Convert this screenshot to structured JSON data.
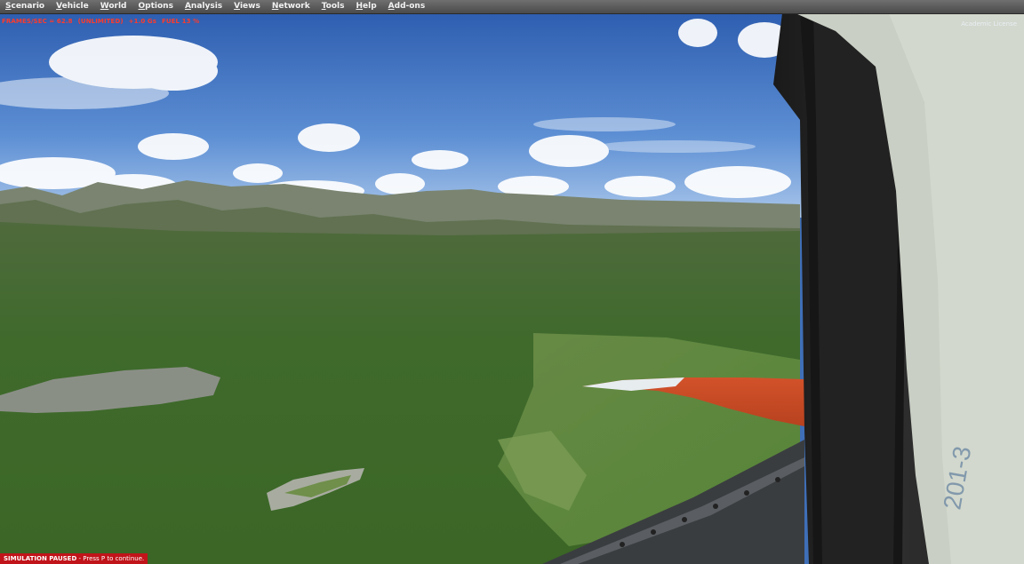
{
  "menu": {
    "items": [
      {
        "ul": "S",
        "rest": "cenario"
      },
      {
        "ul": "V",
        "rest": "ehicle"
      },
      {
        "ul": "W",
        "rest": "orld"
      },
      {
        "ul": "O",
        "rest": "ptions"
      },
      {
        "ul": "A",
        "rest": "nalysis"
      },
      {
        "ul": "V",
        "rest": "iews"
      },
      {
        "ul": "N",
        "rest": "etwork"
      },
      {
        "ul": "T",
        "rest": "ools"
      },
      {
        "ul": "H",
        "rest": "elp"
      },
      {
        "ul": "A",
        "rest": "dd-ons"
      }
    ]
  },
  "hud": {
    "frames": "FRAMES/SEC = 62.8",
    "mode": "(UNLIMITED)",
    "gforce": "+1.0 Gs",
    "fuel": "FUEL 13 %",
    "color": "#ff3a2a"
  },
  "license": "Academic License",
  "status": {
    "paused": "SIMULATION PAUSED",
    "hint": " - Press P to continue.",
    "color": "#c0141a"
  },
  "wing_marking": "201-3"
}
